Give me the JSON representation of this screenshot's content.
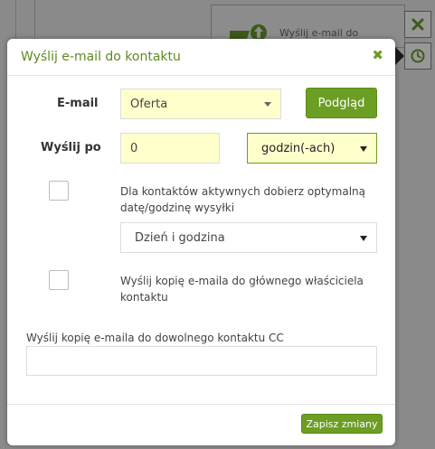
{
  "background": {
    "node_label": "Wyślij e-mail do",
    "node_icon": "email-arrow-up-icon",
    "buttons": [
      {
        "icon": "close-icon"
      },
      {
        "icon": "clock-icon"
      }
    ]
  },
  "modal": {
    "title": "Wyślij e-mail do kontaktu",
    "close_icon": "close-icon",
    "email": {
      "label": "E-mail",
      "selected": "Oferta",
      "preview_button": "Podgląd"
    },
    "send_after": {
      "label": "Wyślij po",
      "value": "0",
      "unit_selected": "godzin(-ach)"
    },
    "optimize": {
      "checked": false,
      "text": "Dla kontaktów aktywnych dobierz optymalną datę/godzinę wysyłki",
      "select_value": "Dzień i godzina"
    },
    "copy_owner": {
      "checked": false,
      "text": "Wyślij kopię e-maila do głównego właściciela kontaktu"
    },
    "cc": {
      "label": "Wyślij kopię e-maila do dowolnego kontaktu CC",
      "value": ""
    },
    "save_button": "Zapisz zmiany"
  },
  "colors": {
    "accent": "#6b9e22",
    "title": "#5f8a1e",
    "highlight_field": "#ffffcc",
    "overlay": "#8a8a8a"
  }
}
